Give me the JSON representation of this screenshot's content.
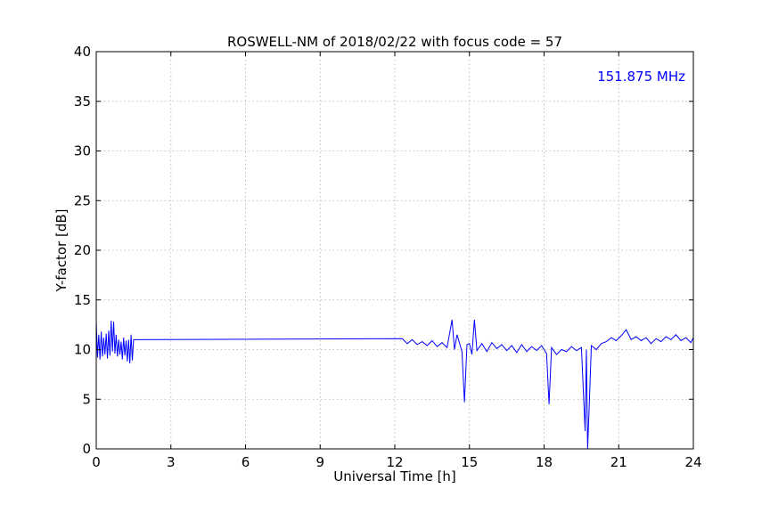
{
  "chart_data": {
    "type": "line",
    "title": "ROSWELL-NM of 2018/02/22 with focus code = 57",
    "xlabel": "Universal Time [h]",
    "ylabel": "Y-factor [dB]",
    "xlim": [
      0,
      24
    ],
    "ylim": [
      0,
      40
    ],
    "xticks": [
      0,
      3,
      6,
      9,
      12,
      15,
      18,
      21,
      24
    ],
    "yticks": [
      0,
      5,
      10,
      15,
      20,
      25,
      30,
      35,
      40
    ],
    "grid": true,
    "annotation": "151.875 MHz",
    "annotation_placement": "top-right",
    "line_color": "#0000ff",
    "series": [
      {
        "x": [
          0.0,
          0.05,
          0.1,
          0.15,
          0.2,
          0.25,
          0.3,
          0.35,
          0.4,
          0.45,
          0.5,
          0.55,
          0.6,
          0.65,
          0.7,
          0.75,
          0.8,
          0.85,
          0.9,
          0.95,
          1.0,
          1.05,
          1.1,
          1.15,
          1.2,
          1.25,
          1.3,
          1.35,
          1.4,
          1.45,
          1.5,
          12.3,
          12.5,
          12.7,
          12.9,
          13.1,
          13.3,
          13.5,
          13.7,
          13.9,
          14.1,
          14.3,
          14.4,
          14.5,
          14.7,
          14.8,
          14.9,
          15.0,
          15.1,
          15.2,
          15.3,
          15.5,
          15.7,
          15.9,
          16.1,
          16.3,
          16.5,
          16.7,
          16.9,
          17.1,
          17.3,
          17.5,
          17.7,
          17.9,
          18.1,
          18.2,
          18.3,
          18.5,
          18.7,
          18.9,
          19.1,
          19.3,
          19.5,
          19.65,
          19.7,
          19.75,
          19.8,
          19.9,
          20.1,
          20.3,
          20.5,
          20.7,
          20.9,
          21.1,
          21.3,
          21.5,
          21.7,
          21.9,
          22.1,
          22.3,
          22.5,
          22.7,
          22.9,
          23.1,
          23.3,
          23.5,
          23.7,
          23.9,
          24.0
        ],
        "y": [
          12.8,
          9.2,
          11.5,
          9.0,
          11.8,
          9.3,
          11.2,
          9.5,
          11.6,
          9.1,
          11.9,
          9.4,
          12.9,
          9.8,
          12.8,
          9.6,
          11.5,
          9.3,
          11.0,
          9.5,
          10.8,
          9.0,
          11.2,
          9.4,
          10.9,
          8.8,
          11.0,
          8.6,
          11.5,
          8.9,
          11.0,
          11.1,
          10.6,
          11.0,
          10.5,
          10.8,
          10.4,
          10.9,
          10.3,
          10.7,
          10.2,
          13.0,
          10.0,
          11.5,
          9.8,
          4.7,
          10.5,
          10.6,
          9.5,
          13.0,
          9.9,
          10.6,
          9.8,
          10.7,
          10.1,
          10.5,
          9.9,
          10.4,
          9.7,
          10.5,
          9.8,
          10.3,
          9.9,
          10.4,
          9.6,
          4.5,
          10.2,
          9.5,
          10.0,
          9.8,
          10.3,
          9.9,
          10.2,
          1.8,
          10.0,
          0.0,
          3.3,
          10.4,
          10.0,
          10.6,
          10.8,
          11.2,
          10.9,
          11.4,
          12.0,
          11.0,
          11.3,
          10.9,
          11.2,
          10.6,
          11.1,
          10.8,
          11.3,
          11.0,
          11.5,
          10.9,
          11.2,
          10.7,
          11.2
        ]
      }
    ]
  }
}
